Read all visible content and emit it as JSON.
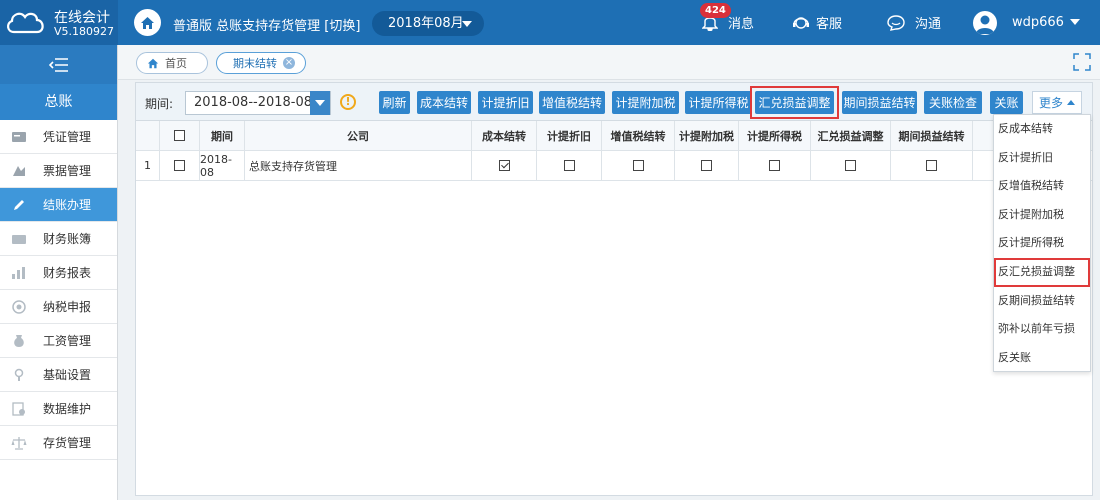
{
  "app": {
    "name": "在线会计",
    "version": "V5.180927"
  },
  "topbar": {
    "company": "普通版 总账支持存货管理 [切换]",
    "period": "2018年08月",
    "message_count": "424",
    "message_label": "消息",
    "service_label": "客服",
    "chat_label": "沟通",
    "username": "wdp666"
  },
  "sidebar": {
    "section_title": "总账",
    "items": [
      {
        "label": "凭证管理",
        "icon": "voucher-icon"
      },
      {
        "label": "票据管理",
        "icon": "bill-icon"
      },
      {
        "label": "结账办理",
        "icon": "pencil-icon",
        "active": true
      },
      {
        "label": "财务账簿",
        "icon": "ledger-icon"
      },
      {
        "label": "财务报表",
        "icon": "report-icon"
      },
      {
        "label": "纳税申报",
        "icon": "tax-icon"
      },
      {
        "label": "工资管理",
        "icon": "salary-icon"
      },
      {
        "label": "基础设置",
        "icon": "settings-icon"
      },
      {
        "label": "数据维护",
        "icon": "data-icon"
      },
      {
        "label": "存货管理",
        "icon": "scale-icon"
      }
    ]
  },
  "tabs": [
    {
      "label": "首页",
      "icon": "home-icon"
    },
    {
      "label": "期末结转",
      "closable": true,
      "active": true
    }
  ],
  "toolbar": {
    "period_label": "期间:",
    "period_value": "2018-08--2018-08",
    "buttons": [
      "刷新",
      "成本结转",
      "计提折旧",
      "增值税结转",
      "计提附加税",
      "计提所得税",
      "汇兑损益调整",
      "期间损益结转",
      "关账检查",
      "关账"
    ],
    "highlighted_button": "汇兑损益调整",
    "more_label": "更多"
  },
  "table": {
    "headers": [
      "",
      "",
      "期间",
      "公司",
      "成本结转",
      "计提折旧",
      "增值税结转",
      "计提附加税",
      "计提所得税",
      "汇兑损益调整",
      "期间损益结转",
      ""
    ],
    "rows": [
      {
        "index": "1",
        "period": "2018-08",
        "company": "总账支持存货管理",
        "checks": [
          true,
          false,
          false,
          false,
          false,
          false,
          false
        ]
      }
    ]
  },
  "more_menu": {
    "items": [
      "反成本结转",
      "反计提折旧",
      "反增值税结转",
      "反计提附加税",
      "反计提所得税",
      "反汇兑损益调整",
      "反期间损益结转",
      "弥补以前年亏损",
      "反关账"
    ],
    "highlighted_item": "反汇兑损益调整"
  },
  "colors": {
    "topbar": "#1e6fb4",
    "primary_button": "#2f85cc",
    "sidebar_active": "#3f97da",
    "highlight_border": "#e03a3a",
    "badge": "#d9303a"
  }
}
